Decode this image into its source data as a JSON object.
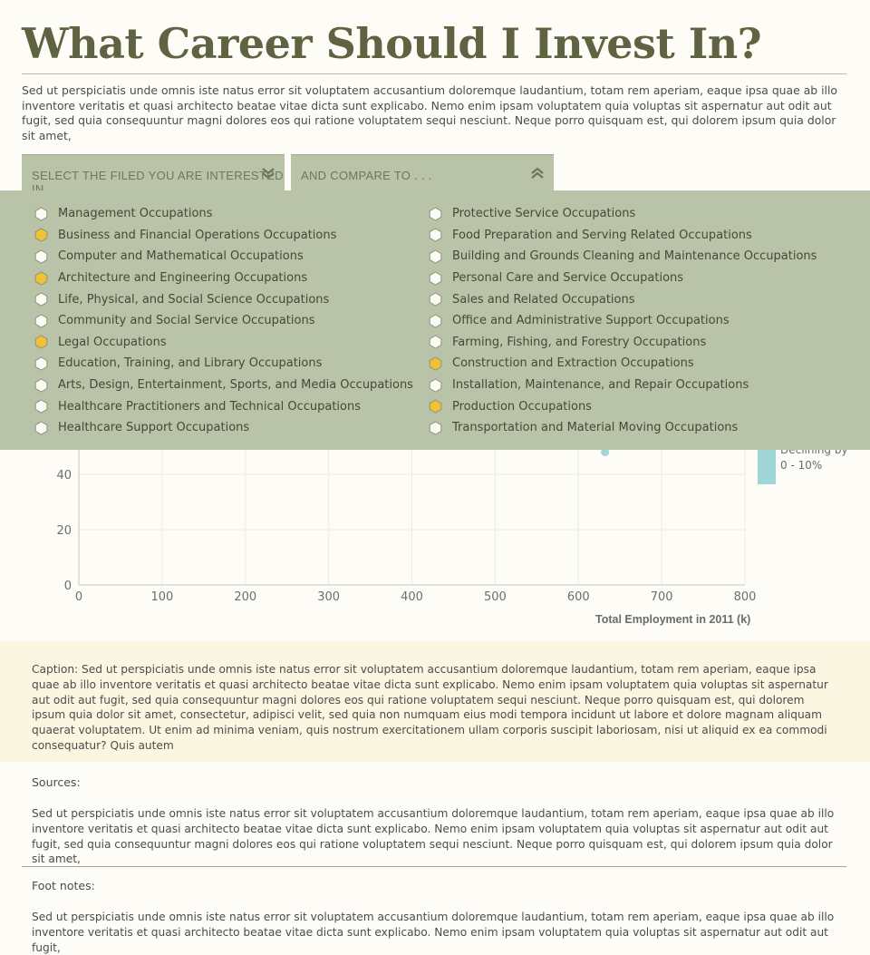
{
  "page": {
    "title": "What Career Should I Invest In?",
    "intro": "Sed ut perspiciatis unde omnis iste natus error sit voluptatem accusantium doloremque laudantium, totam rem aperiam, eaque ipsa quae ab illo inventore veritatis et quasi architecto beatae vitae dicta sunt explicabo. Nemo enim ipsam voluptatem quia voluptas sit aspernatur aut odit aut fugit, sed quia consequuntur magni dolores eos qui ratione voluptatem sequi nesciunt. Neque porro quisquam est, qui dolorem ipsum quia dolor sit amet,"
  },
  "filters": {
    "field_label": "SELECT THE FILED YOU ARE INTERESTED IN",
    "field_icon": "double-chevron-down-icon",
    "compare_label": "AND COMPARE TO . . .",
    "compare_icon": "double-chevron-up-icon"
  },
  "colors": {
    "title": "#5f6341",
    "panel": "#b9c3a7",
    "selected_marker": "#f2c135",
    "unselected_marker": "#fbfaf3",
    "point": "#9fd6d6",
    "caption_bg": "#fbf6e1"
  },
  "occupations": {
    "left": [
      {
        "label": "Management Occupations",
        "selected": false
      },
      {
        "label": "Business and Financial Operations Occupations",
        "selected": true
      },
      {
        "label": "Computer and Mathematical Occupations",
        "selected": false
      },
      {
        "label": "Architecture and Engineering Occupations",
        "selected": true
      },
      {
        "label": "Life, Physical, and Social Science Occupations",
        "selected": false
      },
      {
        "label": "Community and Social Service Occupations",
        "selected": false
      },
      {
        "label": "Legal Occupations",
        "selected": true
      },
      {
        "label": "Education, Training, and Library Occupations",
        "selected": false
      },
      {
        "label": "Arts, Design, Entertainment, Sports, and Media Occupations",
        "selected": false
      },
      {
        "label": "Healthcare Practitioners and Technical Occupations",
        "selected": false
      },
      {
        "label": "Healthcare Support Occupations",
        "selected": false
      }
    ],
    "right": [
      {
        "label": "Protective Service Occupations",
        "selected": false
      },
      {
        "label": "Food Preparation and Serving Related Occupations",
        "selected": false
      },
      {
        "label": "Building and Grounds Cleaning and Maintenance Occupations",
        "selected": false
      },
      {
        "label": "Personal Care and Service Occupations",
        "selected": false
      },
      {
        "label": "Sales and Related Occupations",
        "selected": false
      },
      {
        "label": "Office and Administrative Support Occupations",
        "selected": false
      },
      {
        "label": "Farming, Fishing, and Forestry Occupations",
        "selected": false
      },
      {
        "label": "Construction and Extraction Occupations",
        "selected": true
      },
      {
        "label": "Installation, Maintenance, and Repair Occupations",
        "selected": false
      },
      {
        "label": "Production Occupations",
        "selected": true
      },
      {
        "label": "Transportation and Material Moving Occupations",
        "selected": false
      }
    ]
  },
  "chart_data": {
    "type": "scatter",
    "xlabel": "Total Employment in 2011 (k)",
    "xlim": [
      0,
      800
    ],
    "ylim_visible": [
      0,
      50
    ],
    "x_ticks": [
      0,
      100,
      200,
      300,
      400,
      500,
      600,
      700,
      800
    ],
    "y_ticks": [
      0,
      20,
      40
    ],
    "grid": true,
    "points": [
      {
        "x": 632,
        "y": 48
      }
    ],
    "legend": {
      "label_line1": "Declining by",
      "label_line2": "0 - 10%",
      "placement": "right"
    }
  },
  "caption": {
    "text": "Caption:  Sed ut perspiciatis unde omnis iste natus error sit voluptatem accusantium doloremque laudantium, totam rem aperiam, eaque ipsa quae ab illo inventore veritatis et quasi architecto beatae vitae dicta sunt explicabo. Nemo enim ipsam voluptatem quia voluptas sit aspernatur aut odit aut fugit, sed quia consequuntur magni dolores eos qui ratione voluptatem sequi nesciunt. Neque porro quisquam est, qui dolorem ipsum quia dolor sit amet, consectetur, adipisci velit, sed quia non numquam eius modi tempora incidunt ut labore et dolore magnam aliquam quaerat voluptatem. Ut enim ad minima veniam, quis nostrum exercitationem ullam corporis suscipit laboriosam, nisi ut aliquid ex ea commodi consequatur? Quis autem"
  },
  "sources": {
    "label": "Sources:",
    "text": "Sed ut perspiciatis unde omnis iste natus error sit voluptatem accusantium doloremque laudantium, totam rem aperiam, eaque ipsa quae ab illo inventore veritatis et quasi architecto beatae vitae dicta sunt explicabo. Nemo enim ipsam voluptatem quia voluptas sit aspernatur aut odit aut fugit, sed quia consequuntur magni dolores eos qui ratione voluptatem sequi nesciunt. Neque porro quisquam est, qui dolorem ipsum quia dolor sit amet,"
  },
  "footnotes": {
    "label": "Foot notes:",
    "text": "Sed ut perspiciatis unde omnis iste natus error sit voluptatem accusantium doloremque laudantium, totam rem aperiam, eaque ipsa quae ab illo inventore veritatis et quasi architecto beatae vitae dicta sunt explicabo. Nemo enim ipsam voluptatem quia voluptas sit aspernatur aut odit aut fugit,"
  }
}
